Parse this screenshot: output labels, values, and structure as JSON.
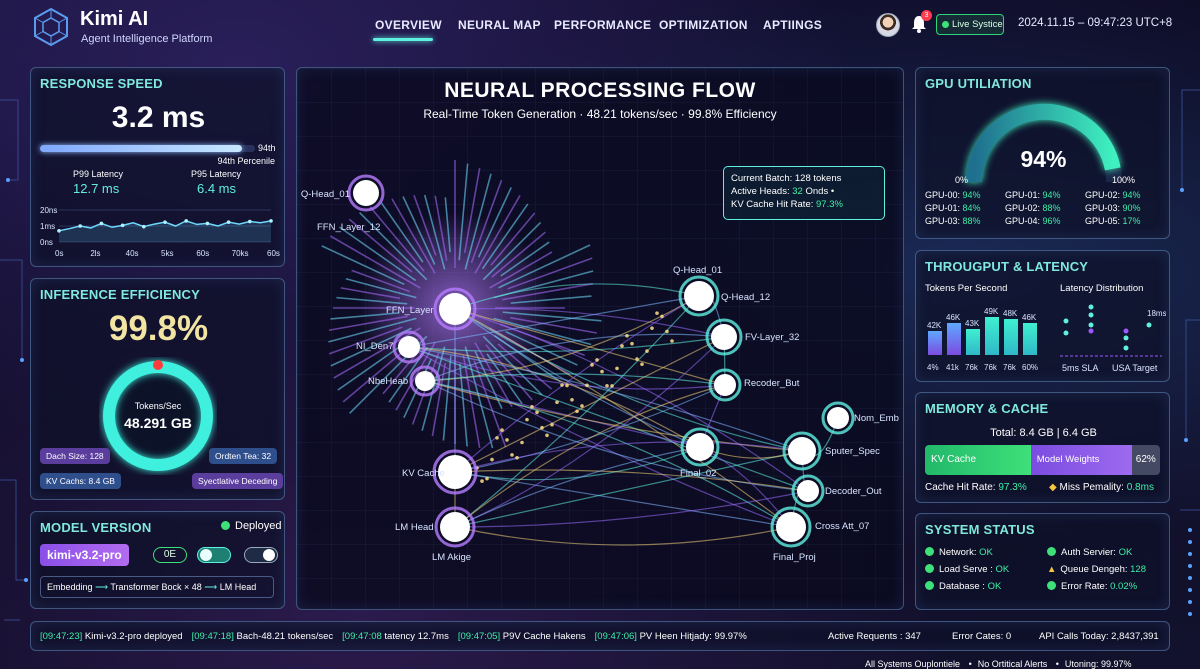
{
  "brand": {
    "name": "Kimi AI",
    "tagline": "Agent Intelligence Platform"
  },
  "nav": {
    "items": [
      "OVERVIEW",
      "NEURAL MAP",
      "PERFORMANCE",
      "OPTIMIZATION",
      "APTIINGS"
    ],
    "active": "OVERVIEW"
  },
  "header": {
    "notif_count": "3",
    "live_label": "Live Systice",
    "datetime": "2024.11.15 – 09:47:23 UTC+8"
  },
  "response": {
    "title": "RESPONSE SPEED",
    "value": "3.2 ms",
    "pct_short": "94th",
    "pct_label": "94th Percenile",
    "progress": 0.94,
    "p99_label": "P99 Latency",
    "p99_value": "12.7 ms",
    "p95_label": "P95 Latency",
    "p95_value": "6.4 ms",
    "y_ticks": [
      "20ns",
      "1ms",
      "0ns"
    ],
    "x_ticks": [
      "0s",
      "2ls",
      "40s",
      "5ks",
      "60s",
      "70ks",
      "60s"
    ],
    "spark": [
      0.35,
      0.42,
      0.5,
      0.44,
      0.58,
      0.46,
      0.52,
      0.6,
      0.48,
      0.56,
      0.62,
      0.5,
      0.66,
      0.55,
      0.58,
      0.5,
      0.62,
      0.56,
      0.64,
      0.6,
      0.66
    ]
  },
  "inference": {
    "title": "INFERENCE EFFICIENCY",
    "value": "99.8%",
    "ring_label": "Tokens/Sec",
    "ring_value": "48.291 GB",
    "ring_fraction": 0.998,
    "tags": [
      "Dach Size: 128",
      "Ordten Tea: 32",
      "KV Cachs: 8.4 GB",
      "Syectlative Deceding"
    ]
  },
  "model": {
    "title": "MODEL VERSION",
    "status": "Deployed",
    "version": "kimi-v3.2-pro",
    "badge": "0E",
    "pipeline": [
      "Embedding",
      "Transformer Bock × 48",
      "LM Head"
    ]
  },
  "neural": {
    "title": "NEURAL PROCESSING FLOW",
    "subtitle": "Real-Time Token Generation · 48.21 tokens/sec · 99.8% Efficiency",
    "tooltip": {
      "l1": "Current Batch:",
      "v1": "128 tokens",
      "l2": "Active Heads:",
      "v2": "32",
      "s2": "Onds  •",
      "l3": "KV Cache Hit Rate:",
      "v3": "97.3%"
    },
    "nodes": [
      "Q-Head_01",
      "FFN_Layer_12",
      "FFN_Layer",
      "NI_Den7",
      "NbeHeab",
      "KV Cache",
      "LM Head",
      "LM Akige",
      "Q-Head_01",
      "Q-Head_12",
      "FV-Layer_32",
      "Recoder_But",
      "Final_02",
      "Sputer_Spec",
      "Nom_Emb",
      "Decoder_Out",
      "Cross Att_07",
      "Final_Proj"
    ]
  },
  "gpu": {
    "title": "GPU UTILIATION",
    "value": "94%",
    "fraction": 0.94,
    "min": "0%",
    "max": "100%",
    "cells": [
      {
        "k": "GPU-00:",
        "v": "94%"
      },
      {
        "k": "GPU-01:",
        "v": "94%"
      },
      {
        "k": "GPU-02:",
        "v": "94%"
      },
      {
        "k": "GPU-01:",
        "v": "84%"
      },
      {
        "k": "GPU-02:",
        "v": "88%"
      },
      {
        "k": "GPU-03:",
        "v": "90%"
      },
      {
        "k": "GPU-03:",
        "v": "88%"
      },
      {
        "k": "GPU-04:",
        "v": "96%"
      },
      {
        "k": "GPU-05:",
        "v": "17%"
      }
    ]
  },
  "throughput": {
    "title": "THROUGPUT & LATENCY",
    "tps_label": "Tokens Per Second",
    "lat_label": "Latency Distribution",
    "bars": [
      {
        "v": "42K",
        "x": "4%",
        "h": 42
      },
      {
        "v": "46K",
        "x": "41k",
        "h": 46
      },
      {
        "v": "43K",
        "x": "76k",
        "h": 43
      },
      {
        "v": "49K",
        "x": "76k",
        "h": 49
      },
      {
        "v": "48K",
        "x": "76k",
        "h": 48
      },
      {
        "v": "46K",
        "x": "60%",
        "h": 46
      }
    ],
    "lat_max": "18ms",
    "sla": "5ms SLA",
    "target": "USA Target"
  },
  "memory": {
    "title": "MEMORY & CACHE",
    "total": "Total: 8.4 GB | 6.4 GB",
    "seg1": "KV Cache",
    "seg2": "Model Weights",
    "seg_pct": "62%",
    "hit_label": "Cache Hit Rate:",
    "hit_value": "97.3%",
    "miss_label": "Miss Pemality:",
    "miss_value": "0.8ms"
  },
  "status": {
    "title": "SYSTEM STATUS",
    "items": [
      {
        "k": "Network:",
        "v": "OK",
        "s": "ok"
      },
      {
        "k": "Auth Servier:",
        "v": "OK",
        "s": "ok"
      },
      {
        "k": "Load Serve :",
        "v": "OK",
        "s": "ok"
      },
      {
        "k": "Queue Dengeh:",
        "v": "128",
        "s": "warn"
      },
      {
        "k": "Database :",
        "v": "OK",
        "s": "ok"
      },
      {
        "k": "Error Rate:",
        "v": "0.02%",
        "s": "ok"
      }
    ]
  },
  "log": {
    "entries": [
      {
        "t": "[09:47:23]",
        "m": "Kimi-v3.2-pro deployed"
      },
      {
        "t": "[09:47:18]",
        "m": "Bach-48.21 tokens/sec"
      },
      {
        "t": "[09:47:08",
        "m": "tatency 12.7ms"
      },
      {
        "t": "[09:47:05]",
        "m": "P9V Cache Hakens"
      },
      {
        "t": "[09:47:06]",
        "m": "PV Heen Hitjady: 99.97%"
      }
    ],
    "requests_label": "Active Requents :",
    "requests": "347",
    "errors_label": "Error Cates:",
    "errors": "0",
    "calls_label": "API Calls Today:",
    "calls": "2,8437,391"
  },
  "footer": {
    "items": [
      "All Systems Ouplontiele",
      "No Ortitical Alerts",
      "Utoning: 99.97%"
    ]
  },
  "colors": {
    "accent": "#5ff0e0",
    "green": "#3ff0a8",
    "purple": "#9b59ff",
    "panel_border": "#78aae6"
  }
}
